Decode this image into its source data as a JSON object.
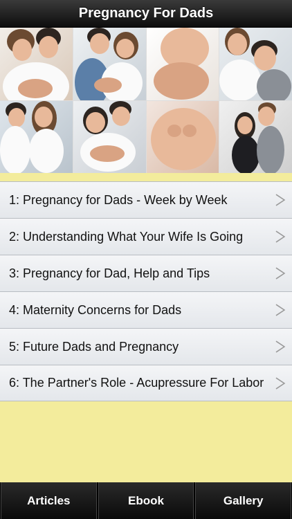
{
  "header": {
    "title": "Pregnancy For Dads"
  },
  "banner": {
    "photos": [
      "couple-photo",
      "couple-photo",
      "pregnant-belly-photo",
      "couple-photo",
      "couple-photo",
      "couple-photo",
      "heart-hands-photo",
      "couple-photo"
    ]
  },
  "articles": [
    {
      "label": "1: Pregnancy for Dads - Week by Week",
      "icon": "chevron-right-icon"
    },
    {
      "label": "2: Understanding What Your Wife Is Going",
      "icon": "chevron-right-icon"
    },
    {
      "label": "3: Pregnancy for Dad, Help and Tips",
      "icon": "chevron-right-icon"
    },
    {
      "label": "4: Maternity Concerns for Dads",
      "icon": "chevron-right-icon"
    },
    {
      "label": "5: Future Dads and Pregnancy",
      "icon": "chevron-right-icon"
    },
    {
      "label": "6: The Partner's Role - Acupressure For Labor",
      "icon": "chevron-right-icon"
    }
  ],
  "tabs": [
    {
      "label": "Articles"
    },
    {
      "label": "Ebook"
    },
    {
      "label": "Gallery"
    }
  ],
  "colors": {
    "background": "#f3ec9c",
    "nav_bar": "#1a1a1a",
    "row": "#eceef1",
    "chevron": "#9a9a9a"
  }
}
